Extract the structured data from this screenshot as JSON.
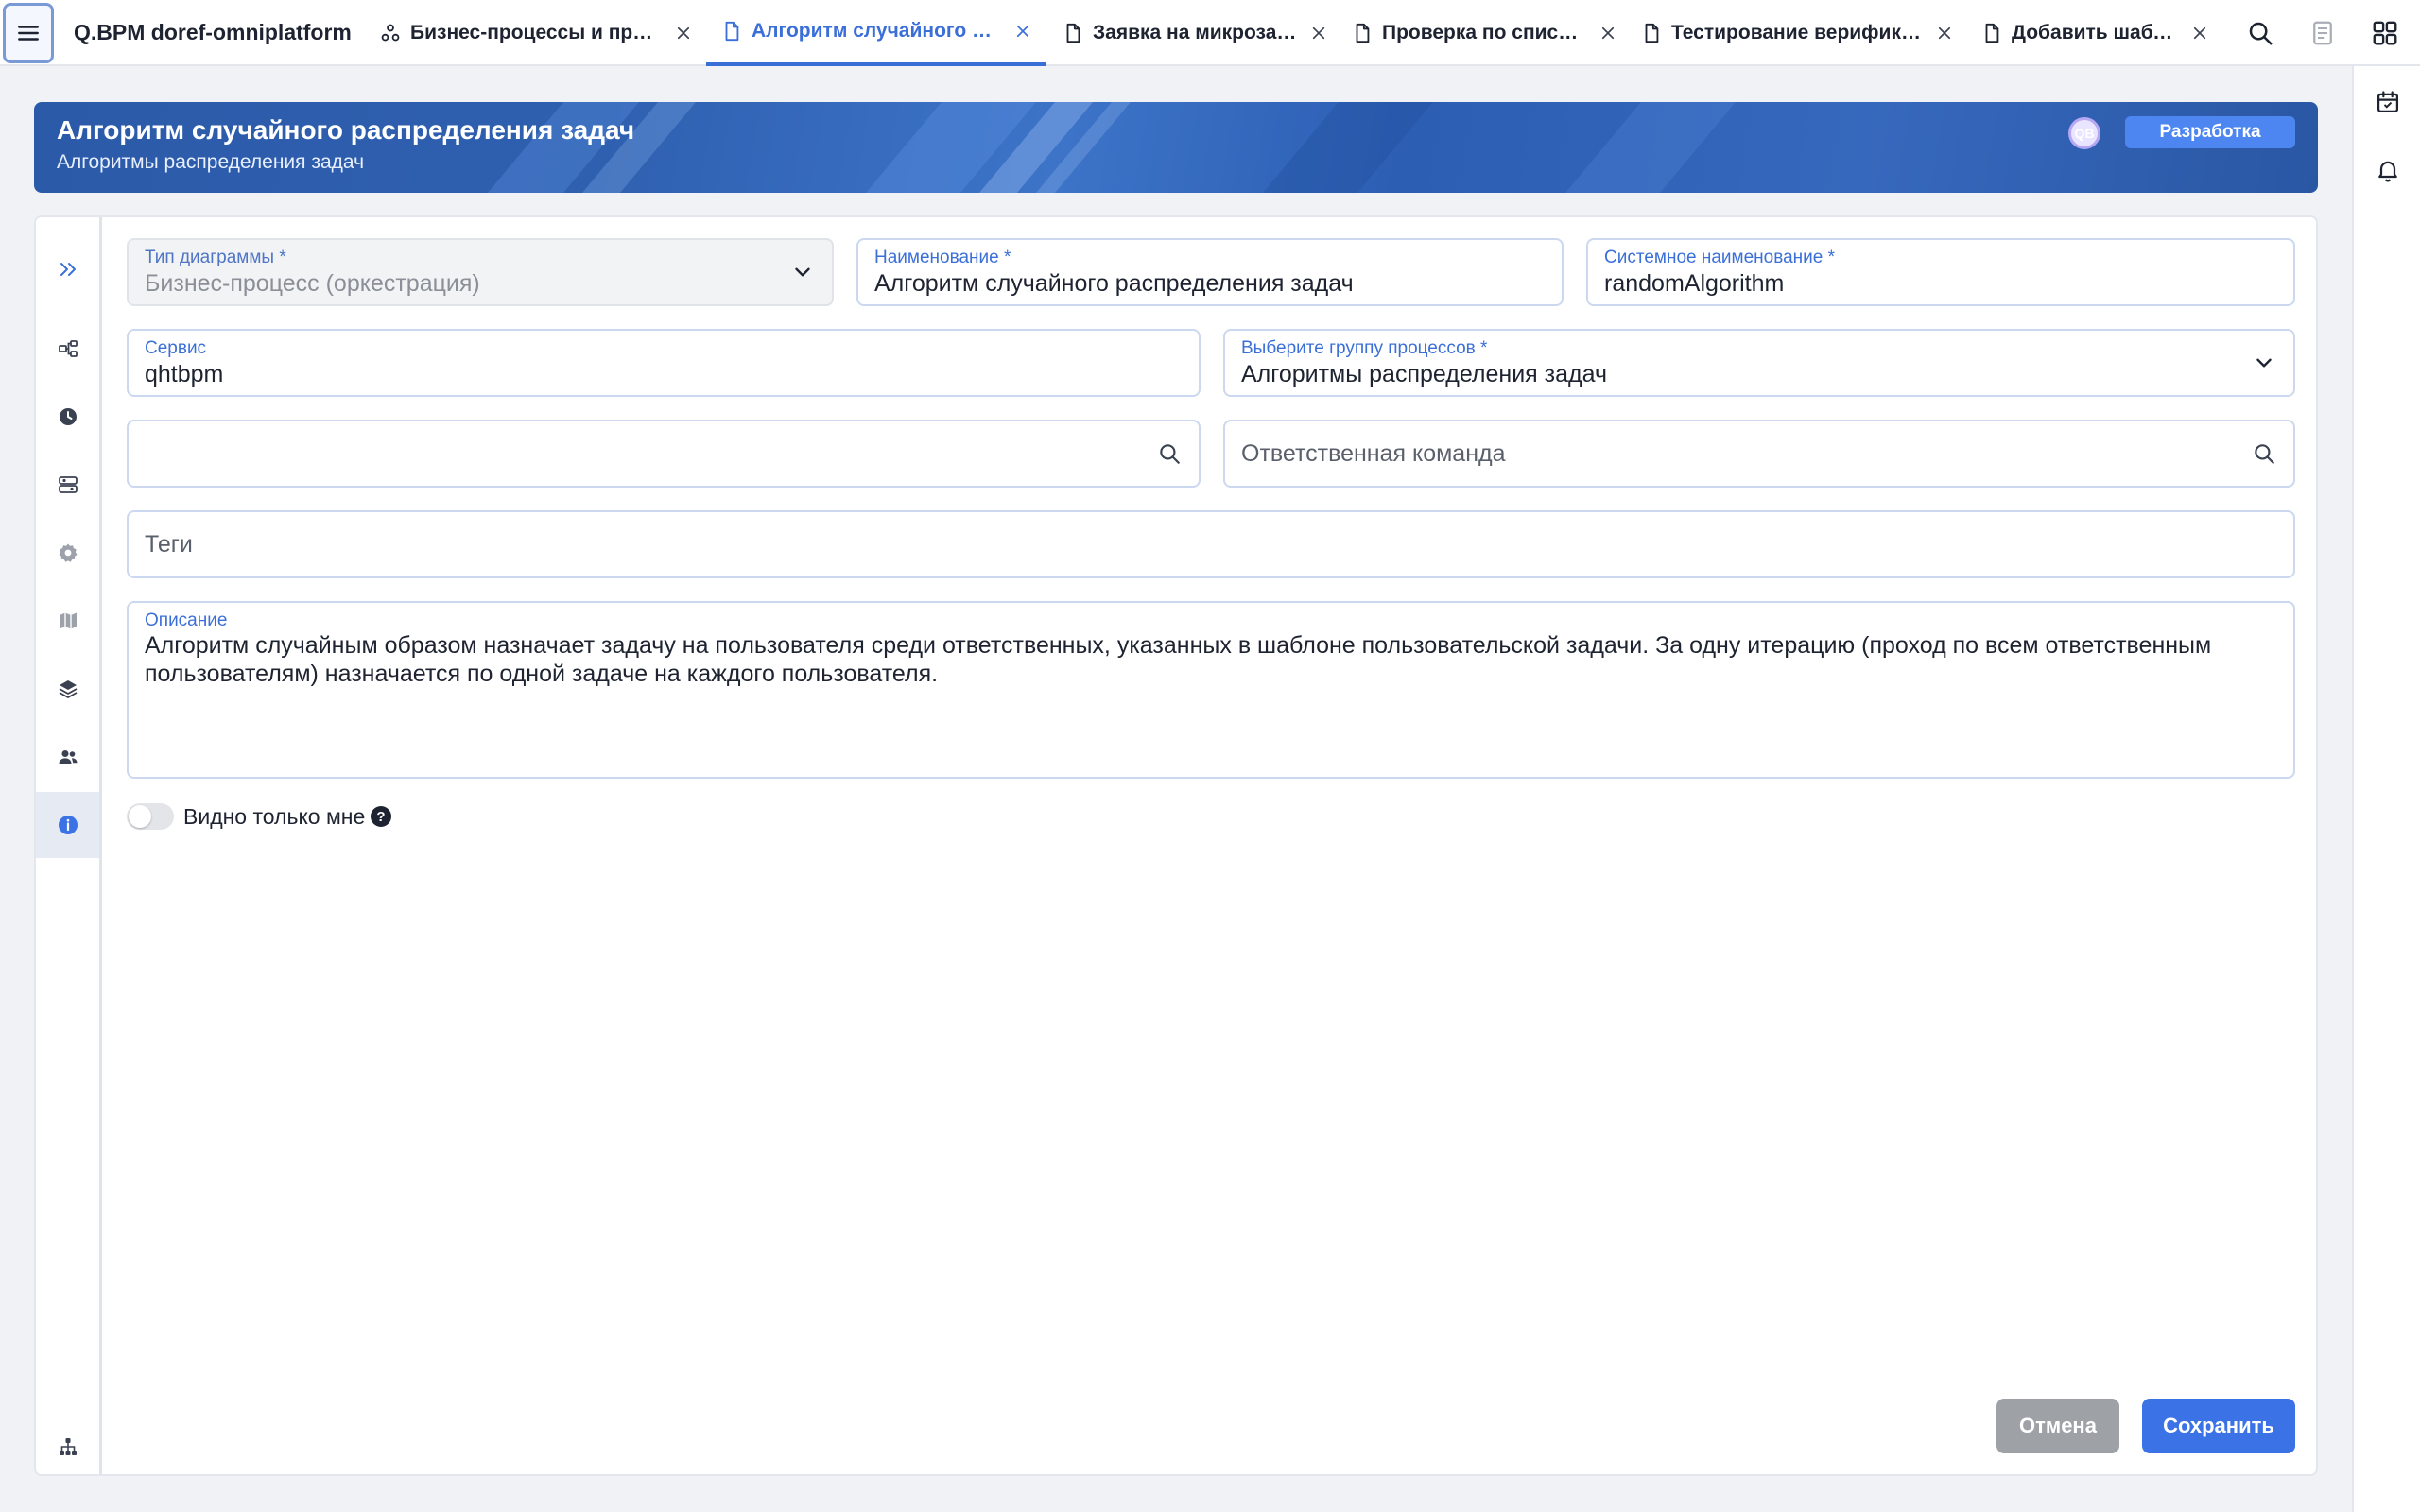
{
  "app": {
    "title": "Q.BPM doref-omniplatform"
  },
  "tabs": [
    {
      "label": "Бизнес-процессы и прав...",
      "icon": "process-icon",
      "active": false
    },
    {
      "label": "Алгоритм случайного ра...",
      "icon": "document-icon",
      "active": true
    },
    {
      "label": "Заявка на микрозайм",
      "icon": "document-icon",
      "active": false
    },
    {
      "label": "Проверка по спискам",
      "icon": "document-icon",
      "active": false
    },
    {
      "label": "Тестирование верифика...",
      "icon": "document-icon",
      "active": false
    },
    {
      "label": "Добавить шаблон",
      "icon": "document-icon",
      "active": false
    }
  ],
  "header": {
    "title": "Алгоритм случайного распределения задач",
    "subtitle": "Алгоритмы распределения задач",
    "avatar_initials": "QB",
    "status_badge": "Разработка"
  },
  "form": {
    "diagram_type": {
      "label": "Тип диаграммы *",
      "value": "Бизнес-процесс (оркестрация)"
    },
    "name": {
      "label": "Наименование *",
      "value": "Алгоритм случайного распределения задач"
    },
    "system_name": {
      "label": "Системное наименование *",
      "value": "randomAlgorithm"
    },
    "service": {
      "label": "Сервис",
      "value": "qhtbpm"
    },
    "process_group": {
      "label": "Выберите группу процессов *",
      "value": "Алгоритмы распределения задач"
    },
    "owner_search": {
      "placeholder": ""
    },
    "team": {
      "placeholder": "Ответственная команда"
    },
    "tags": {
      "placeholder": "Теги"
    },
    "description": {
      "label": "Описание",
      "value": "Алгоритм случайным образом назначает задачу на пользователя среди ответственных, указанных в шаблоне пользовательской задачи. За одну итерацию (проход по всем ответственным пользователям) назначается по одной задаче на каждого пользователя."
    },
    "visible_only_me": {
      "label": "Видно только мне",
      "checked": false
    }
  },
  "actions": {
    "cancel": "Отмена",
    "save": "Сохранить"
  },
  "colors": {
    "accent": "#3b6fd8",
    "banner": "#2f60b0",
    "badge": "#4d86f0",
    "cancel": "#9ea1a6",
    "save": "#3b73e6"
  }
}
